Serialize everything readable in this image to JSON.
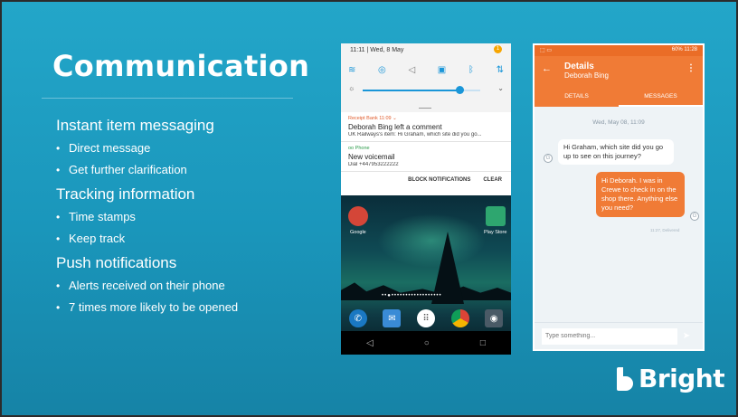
{
  "slide": {
    "title": "Communication",
    "sections": [
      {
        "heading": "Instant item messaging",
        "bullets": [
          "Direct message",
          "Get further clarification"
        ]
      },
      {
        "heading": "Tracking information",
        "bullets": [
          "Time stamps",
          "Keep track"
        ]
      },
      {
        "heading": "Push notifications",
        "bullets": [
          "Alerts received on their phone",
          "7 times more likely to be opened"
        ]
      }
    ]
  },
  "phone1": {
    "status_time": "11:11",
    "status_date": "Wed, 8 May",
    "badge": "1",
    "notifications": [
      {
        "app": "Receipt Bank  11:09 ⌄",
        "title": "Deborah Bing left a comment",
        "text": "UK Railways's item: Hi Graham, which site did you go..."
      },
      {
        "app": "Phone",
        "title": "New voicemail",
        "text": "Dial +447953222222"
      }
    ],
    "actions": {
      "block": "BLOCK NOTIFICATIONS",
      "clear": "CLEAR"
    },
    "home_apps": {
      "left": "Google",
      "right": "Play Store"
    },
    "brightness_level": 0.82
  },
  "phone2": {
    "status_text": "60% 11:28",
    "header_title": "Details",
    "header_subtitle": "Deborah Bing",
    "tabs": [
      "DETAILS",
      "MESSAGES"
    ],
    "active_tab": "MESSAGES",
    "date_label": "Wed, May 08, 11:09",
    "incoming_message": "Hi Graham, which site did you go up to see on this journey?",
    "outgoing_message": "Hi Deborah. I was in Crewe to check in on the shop there. Anything else you need?",
    "delivered_label": "11:27, Delivered",
    "avatar_letter": "G",
    "compose_placeholder": "Type something..."
  },
  "logo": {
    "word": "Bright"
  },
  "colors": {
    "background": "#1a96bb",
    "accent": "#f07b36"
  }
}
